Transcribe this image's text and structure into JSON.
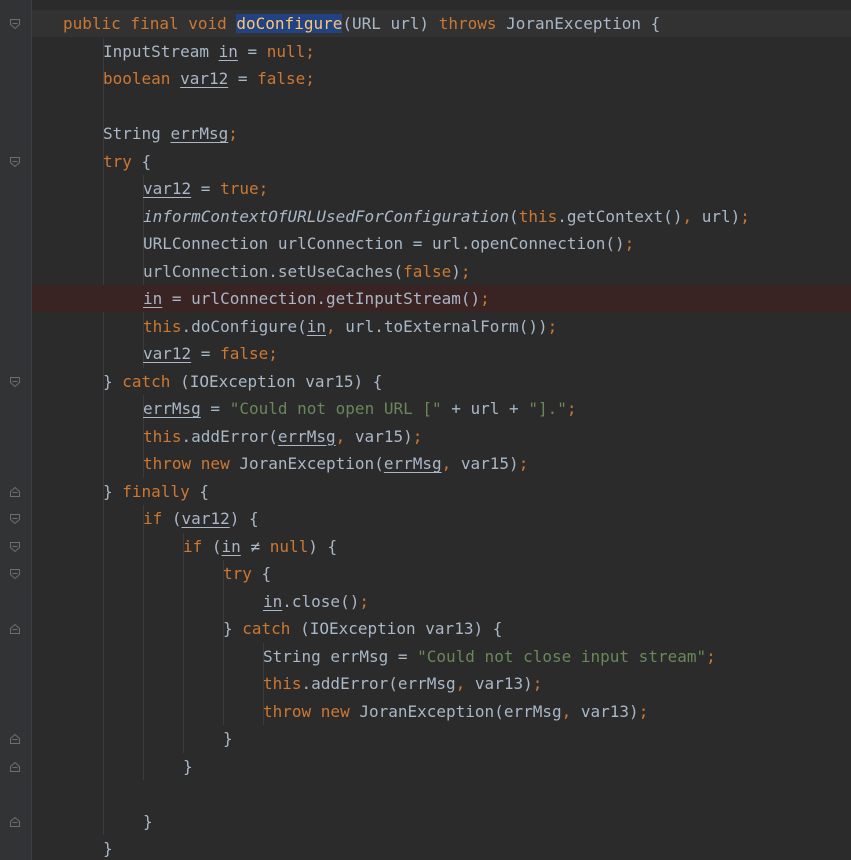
{
  "editor": {
    "colors": {
      "background": "#2b2b2b",
      "keyword": "#cc7832",
      "string": "#6a8759",
      "text": "#a9b7c6",
      "selection": "#214283",
      "breakpoint_line": "#3a2323"
    },
    "lines": [
      {
        "tokens": [
          [
            "kw",
            "public final void "
          ],
          [
            "method-hl",
            "doConfigure"
          ],
          [
            "plain",
            "(URL url) "
          ],
          [
            "kw",
            "throws "
          ],
          [
            "plain",
            "JoranException {"
          ]
        ]
      },
      {
        "tokens": [
          [
            "plain",
            "InputStream "
          ],
          [
            "ul",
            "in"
          ],
          [
            "plain",
            " = "
          ],
          [
            "kw",
            "null;"
          ]
        ]
      },
      {
        "tokens": [
          [
            "kw",
            "boolean "
          ],
          [
            "ul",
            "var12"
          ],
          [
            "plain",
            " = "
          ],
          [
            "kw",
            "false;"
          ]
        ]
      },
      {
        "tokens": []
      },
      {
        "tokens": [
          [
            "plain",
            "String "
          ],
          [
            "ul",
            "errMsg"
          ],
          [
            "kw",
            ";"
          ]
        ]
      },
      {
        "tokens": [
          [
            "kw",
            "try "
          ],
          [
            "plain",
            "{"
          ]
        ]
      },
      {
        "tokens": [
          [
            "ul",
            "var12"
          ],
          [
            "plain",
            " = "
          ],
          [
            "kw",
            "true;"
          ]
        ]
      },
      {
        "tokens": [
          [
            "ital",
            "informContextOfURLUsedForConfiguration"
          ],
          [
            "plain",
            "("
          ],
          [
            "kw",
            "this"
          ],
          [
            "plain",
            ".getContext()"
          ],
          [
            "kw",
            ", "
          ],
          [
            "plain",
            "url)"
          ],
          [
            "kw",
            ";"
          ]
        ]
      },
      {
        "tokens": [
          [
            "plain",
            "URLConnection urlConnection = url.openConnection()"
          ],
          [
            "kw",
            ";"
          ]
        ]
      },
      {
        "tokens": [
          [
            "plain",
            "urlConnection.setUseCaches("
          ],
          [
            "kw",
            "false"
          ],
          [
            "plain",
            ")"
          ],
          [
            "kw",
            ";"
          ]
        ]
      },
      {
        "tokens": [
          [
            "ul",
            "in"
          ],
          [
            "plain",
            " = urlConnection.getInputStream()"
          ],
          [
            "kw",
            ";"
          ]
        ]
      },
      {
        "tokens": [
          [
            "kw",
            "this"
          ],
          [
            "plain",
            ".doConfigure("
          ],
          [
            "ul",
            "in"
          ],
          [
            "kw",
            ", "
          ],
          [
            "plain",
            "url.toExternalForm())"
          ],
          [
            "kw",
            ";"
          ]
        ]
      },
      {
        "tokens": [
          [
            "ul",
            "var12"
          ],
          [
            "plain",
            " = "
          ],
          [
            "kw",
            "false;"
          ]
        ]
      },
      {
        "tokens": [
          [
            "plain",
            "} "
          ],
          [
            "kw",
            "catch "
          ],
          [
            "plain",
            "(IOException var15) {"
          ]
        ]
      },
      {
        "tokens": [
          [
            "ul",
            "errMsg"
          ],
          [
            "plain",
            " = "
          ],
          [
            "str",
            "\"Could not open URL [\""
          ],
          [
            "plain",
            " + url + "
          ],
          [
            "str",
            "\"].\""
          ],
          [
            "kw",
            ";"
          ]
        ]
      },
      {
        "tokens": [
          [
            "kw",
            "this"
          ],
          [
            "plain",
            ".addError("
          ],
          [
            "ul",
            "errMsg"
          ],
          [
            "kw",
            ", "
          ],
          [
            "plain",
            "var15)"
          ],
          [
            "kw",
            ";"
          ]
        ]
      },
      {
        "tokens": [
          [
            "kw",
            "throw new "
          ],
          [
            "plain",
            "JoranException("
          ],
          [
            "ul",
            "errMsg"
          ],
          [
            "kw",
            ", "
          ],
          [
            "plain",
            "var15)"
          ],
          [
            "kw",
            ";"
          ]
        ]
      },
      {
        "tokens": [
          [
            "plain",
            "} "
          ],
          [
            "kw",
            "finally "
          ],
          [
            "plain",
            "{"
          ]
        ]
      },
      {
        "tokens": [
          [
            "kw",
            "if "
          ],
          [
            "plain",
            "("
          ],
          [
            "ul",
            "var12"
          ],
          [
            "plain",
            ") {"
          ]
        ]
      },
      {
        "tokens": [
          [
            "kw",
            "if "
          ],
          [
            "plain",
            "("
          ],
          [
            "ul",
            "in"
          ],
          [
            "plain",
            " ≠ "
          ],
          [
            "kw",
            "null"
          ],
          [
            "plain",
            ") {"
          ]
        ]
      },
      {
        "tokens": [
          [
            "kw",
            "try "
          ],
          [
            "plain",
            "{"
          ]
        ]
      },
      {
        "tokens": [
          [
            "ul",
            "in"
          ],
          [
            "plain",
            ".close()"
          ],
          [
            "kw",
            ";"
          ]
        ]
      },
      {
        "tokens": [
          [
            "plain",
            "} "
          ],
          [
            "kw",
            "catch "
          ],
          [
            "plain",
            "(IOException var13) {"
          ]
        ]
      },
      {
        "tokens": [
          [
            "plain",
            "String errMsg = "
          ],
          [
            "str",
            "\"Could not close input stream\""
          ],
          [
            "kw",
            ";"
          ]
        ]
      },
      {
        "tokens": [
          [
            "kw",
            "this"
          ],
          [
            "plain",
            ".addError(errMsg"
          ],
          [
            "kw",
            ", "
          ],
          [
            "plain",
            "var13)"
          ],
          [
            "kw",
            ";"
          ]
        ]
      },
      {
        "tokens": [
          [
            "kw",
            "throw new "
          ],
          [
            "plain",
            "JoranException(errMsg"
          ],
          [
            "kw",
            ", "
          ],
          [
            "plain",
            "var13)"
          ],
          [
            "kw",
            ";"
          ]
        ]
      },
      {
        "tokens": [
          [
            "plain",
            "}"
          ]
        ]
      },
      {
        "tokens": [
          [
            "plain",
            "}"
          ]
        ]
      },
      {
        "tokens": []
      },
      {
        "tokens": [
          [
            "plain",
            "}"
          ]
        ]
      },
      {
        "tokens": [
          [
            "plain",
            "}"
          ]
        ]
      }
    ]
  }
}
